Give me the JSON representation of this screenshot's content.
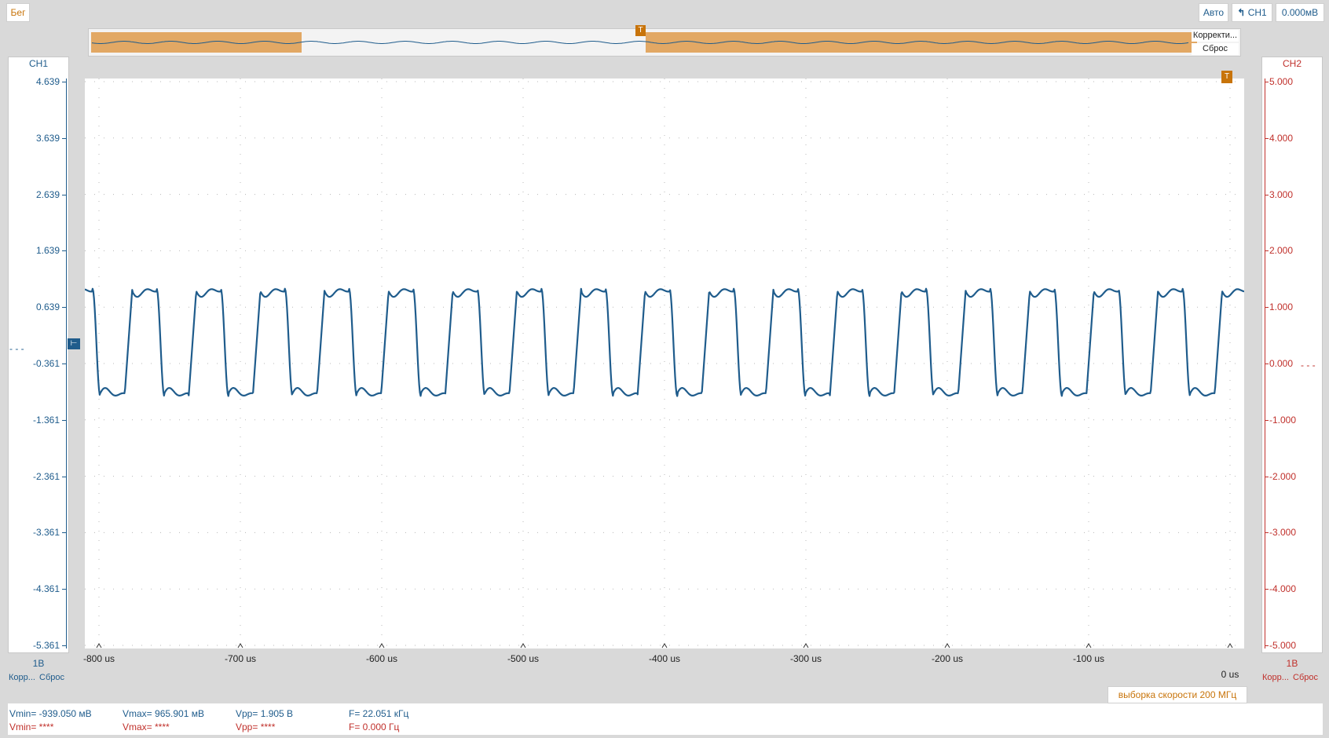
{
  "top": {
    "run_label": "Бег",
    "mode_label": "Авто",
    "trigger_channel": "CH1",
    "trigger_level": "0.000мВ"
  },
  "overview": {
    "adjust_label": "Корректи...",
    "reset_label": "Сброс",
    "trigger_marker": "T"
  },
  "ch1_panel": {
    "title": "CH1",
    "scale": "1В",
    "adjust_label": "Корр...",
    "reset_label": "Сброс",
    "ticks": [
      "4.639",
      "3.639",
      "2.639",
      "1.639",
      "0.639",
      "-0.361",
      "-1.361",
      "-2.361",
      "-3.361",
      "-4.361",
      "-5.361"
    ],
    "color": "#1f5c8c"
  },
  "ch2_panel": {
    "title": "CH2",
    "scale": "1В",
    "adjust_label": "Корр...",
    "reset_label": "Сброс",
    "ticks": [
      "5.000",
      "4.000",
      "3.000",
      "2.000",
      "1.000",
      "0.000",
      "-1.000",
      "-2.000",
      "-3.000",
      "-4.000",
      "-5.000"
    ],
    "color": "#c0302b"
  },
  "plot": {
    "trigger_marker": "T",
    "x_ticks": [
      "-800 us",
      "-700 us",
      "-600 us",
      "-500 us",
      "-400 us",
      "-300 us",
      "-200 us",
      "-100 us",
      "0 us"
    ],
    "sample_rate": "выборка скорости 200 МГц"
  },
  "chart_data": {
    "type": "line",
    "xlabel": "",
    "ylabel": "",
    "x_range_us": [
      -810,
      10
    ],
    "ylim": [
      -5.361,
      4.639
    ],
    "series": [
      {
        "name": "CH1",
        "color": "#1f5c8c",
        "frequency_khz": 22.051,
        "vmin_v": -0.939,
        "vmax_v": 0.966
      }
    ]
  },
  "measurements": {
    "ch1": {
      "vmin": "Vmin= -939.050 мВ",
      "vmax": "Vmax= 965.901 мВ",
      "vpp": "Vpp= 1.905 В",
      "freq": "F= 22.051 кГц"
    },
    "ch2": {
      "vmin": "Vmin= ****",
      "vmax": "Vmax= ****",
      "vpp": "Vpp= ****",
      "freq": "F= 0.000 Гц"
    }
  }
}
